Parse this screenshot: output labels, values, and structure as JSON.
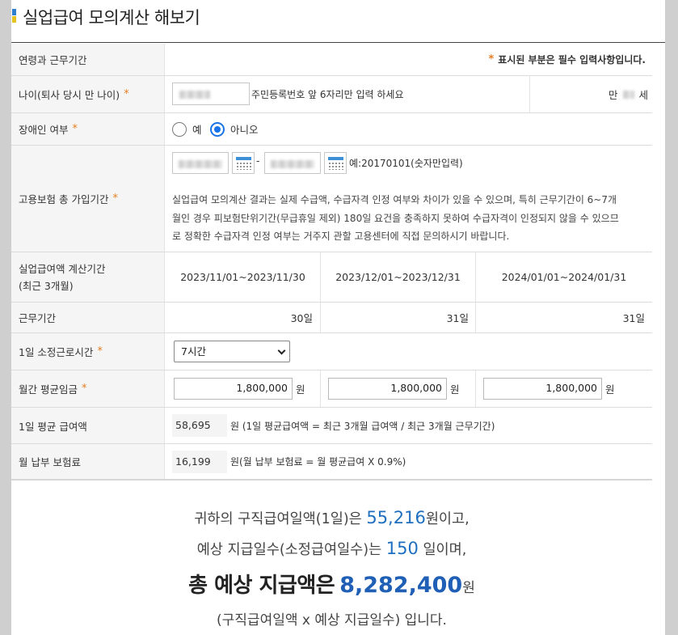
{
  "title": "실업급여 모의계산 해보기",
  "required_mark": "*",
  "header": {
    "label": "연령과 근무기간",
    "note": "표시된 부분은 필수 입력사항입니다."
  },
  "age": {
    "label": "나이(퇴사 당시 만 나이)",
    "hint": "주민등록번호 앞 6자리만 입력 하세요",
    "prefix": "만",
    "suffix": "세"
  },
  "disability": {
    "label": "장애인 여부",
    "yes": "예",
    "no": "아니오",
    "selected": "no"
  },
  "insurance": {
    "label": "고용보험 총 가입기간",
    "range_sep": "-",
    "example": "예:20170101(숫자만입력)",
    "notice_lines": [
      "실업급여 모의계산 결과는 실제 수급액, 수급자격 인정 여부와 차이가 있을 수 있으며, 특히 근무기간이 6~7개",
      "월인 경우 피보험단위기간(무급휴일 제외) 180일 요건을 충족하지 못하여 수급자격이 인정되지 않을 수 있으므",
      "로 정확한 수급자격 인정 여부는 거주지 관할 고용센터에 직접 문의하시기 바랍니다."
    ]
  },
  "period": {
    "label_line1": "실업급여액 계산기간",
    "label_line2": "(최근 3개월)",
    "ranges": [
      "2023/11/01~2023/11/30",
      "2023/12/01~2023/12/31",
      "2024/01/01~2024/01/31"
    ]
  },
  "workdays": {
    "label": "근무기간",
    "values": [
      "30일",
      "31일",
      "31일"
    ]
  },
  "hours": {
    "label": "1일 소정근로시간",
    "selected": "7시간"
  },
  "wage": {
    "label": "월간 평균임금",
    "values": [
      "1,800,000",
      "1,800,000",
      "1,800,000"
    ],
    "unit": "원"
  },
  "daily_avg": {
    "label": "1일 평균 급여액",
    "value": "58,695",
    "note": "원 (1일 평균급여액 = 최근 3개월 급여액 / 최근 3개월 근무기간)"
  },
  "premium": {
    "label": "월 납부 보험료",
    "value": "16,199",
    "note": "원(월 납부 보험료 = 월 평균급여 X 0.9%)"
  },
  "result": {
    "l1_pre": "귀하의 구직급여일액(1일)은 ",
    "l1_val": "55,216",
    "l1_post": "원이고,",
    "l2_pre": "예상 지급일수(소정급여일수)는 ",
    "l2_val": "150",
    "l2_post": " 일이며,",
    "l3_pre": "총 예상 지급액은",
    "l3_small": "은 ",
    "l3_val": "8,282,400",
    "l3_post": "원",
    "l4": "(구직급여일액 x 예상 지급일수) 입니다."
  },
  "colors": {
    "accent_blue": "#1f6fc0",
    "required_orange": "#e67e22",
    "title_mark_blue": "#2e7fd0",
    "title_mark_yellow": "#e4c322"
  }
}
